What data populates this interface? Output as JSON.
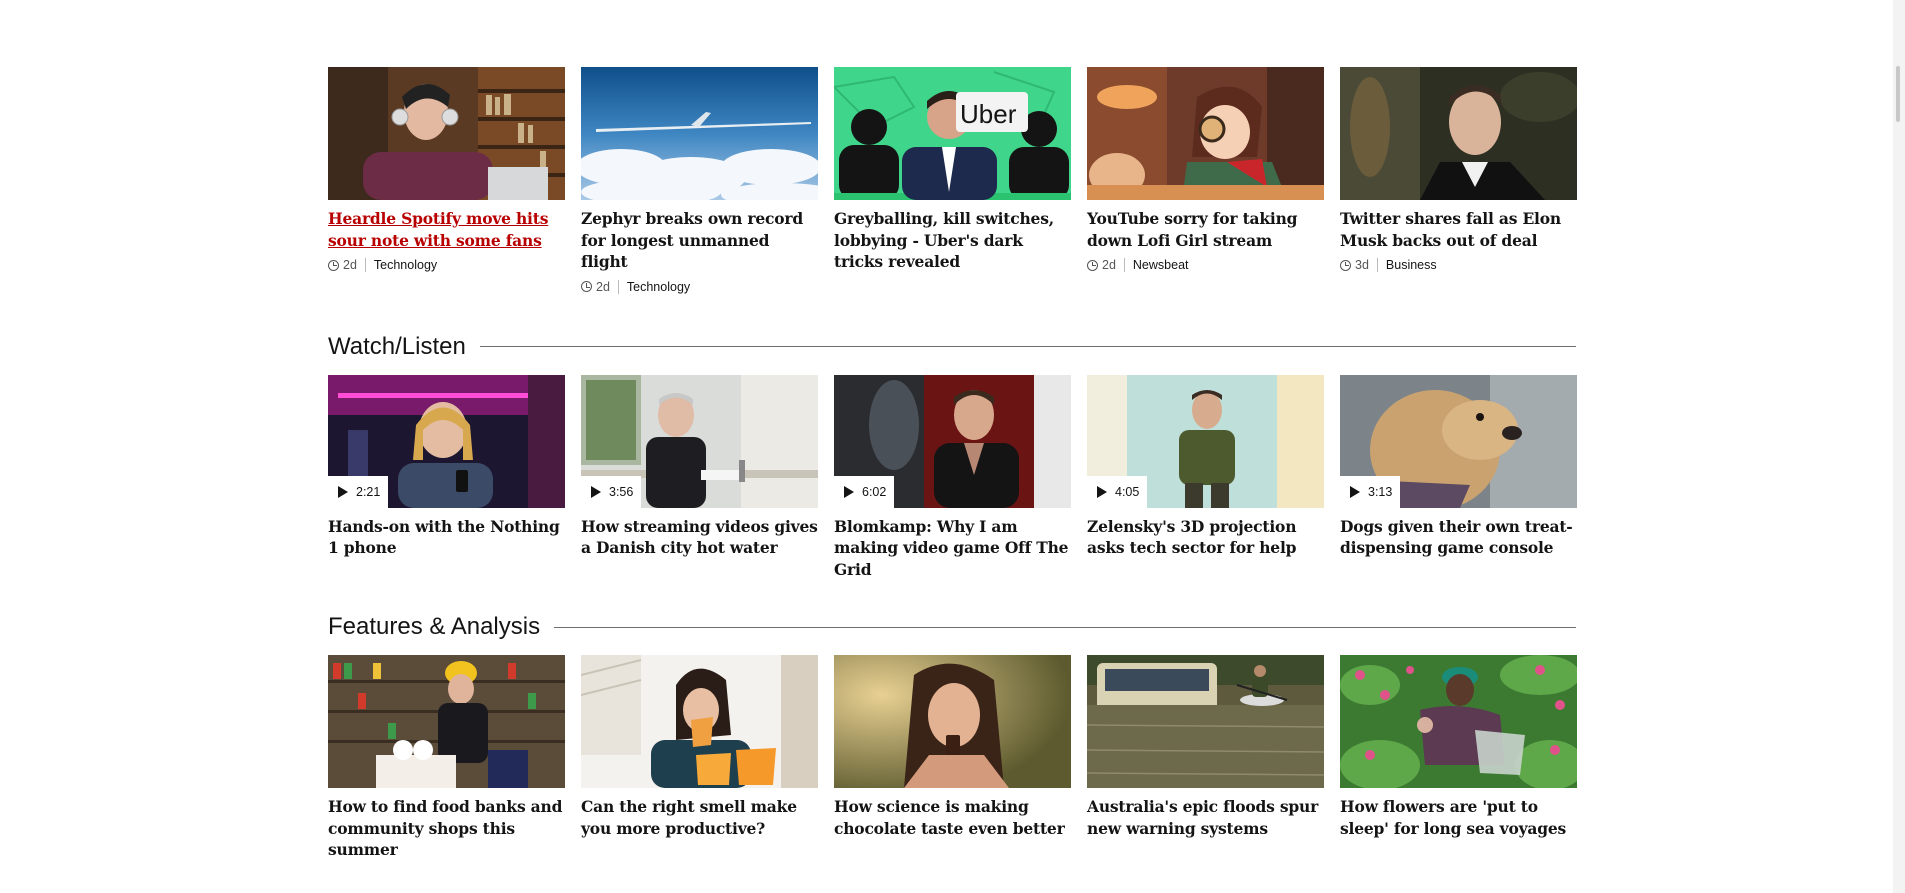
{
  "top_stories": [
    {
      "title": "Heardle Spotify move hits sour note with some fans",
      "age": "2d",
      "category": "Technology",
      "active": true,
      "image": "woman-headphones-library"
    },
    {
      "title": "Zephyr breaks own record for longest unmanned flight",
      "age": "2d",
      "category": "Technology",
      "image": "solar-aircraft-clouds"
    },
    {
      "title": "Greyballing, kill switches, lobbying - Uber's dark tricks revealed",
      "age": "",
      "category": "",
      "image": "uber-executive-silhouettes",
      "logo_text": "Uber"
    },
    {
      "title": "YouTube sorry for taking down Lofi Girl stream",
      "age": "2d",
      "category": "Newsbeat",
      "image": "lofi-girl-anime"
    },
    {
      "title": "Twitter shares fall as Elon Musk backs out of deal",
      "age": "3d",
      "category": "Business",
      "image": "elon-musk-portrait"
    }
  ],
  "watch_listen": {
    "heading": "Watch/Listen",
    "items": [
      {
        "title": "Hands-on with the Nothing 1 phone",
        "duration": "2:21",
        "image": "presenter-neon-studio"
      },
      {
        "title": "How streaming videos gives a Danish city hot water",
        "duration": "3:56",
        "image": "man-washing-dishes"
      },
      {
        "title": "Blomkamp: Why I am making video game Off The Grid",
        "duration": "6:02",
        "image": "director-interview"
      },
      {
        "title": "Zelensky's 3D projection asks tech sector for help",
        "duration": "4:05",
        "image": "zelensky-hologram"
      },
      {
        "title": "Dogs given their own treat-dispensing game console",
        "duration": "3:13",
        "image": "terrier-dog"
      }
    ]
  },
  "features": {
    "heading": "Features & Analysis",
    "items": [
      {
        "title": "How to find food banks and community shops this summer",
        "image": "food-bank-shelves"
      },
      {
        "title": "Can the right smell make you more productive?",
        "image": "woman-smelling-candle"
      },
      {
        "title": "How science is making chocolate taste even better",
        "image": "woman-eating-chocolate"
      },
      {
        "title": "Australia's epic floods spur new warning systems",
        "image": "flooded-bus-kayak"
      },
      {
        "title": "How flowers are 'put to sleep' for long sea voyages",
        "image": "woman-picking-roses"
      }
    ]
  },
  "colors": {
    "accent": "#b80000",
    "text": "#141414",
    "muted": "#545658",
    "rule": "#6e6e73"
  }
}
